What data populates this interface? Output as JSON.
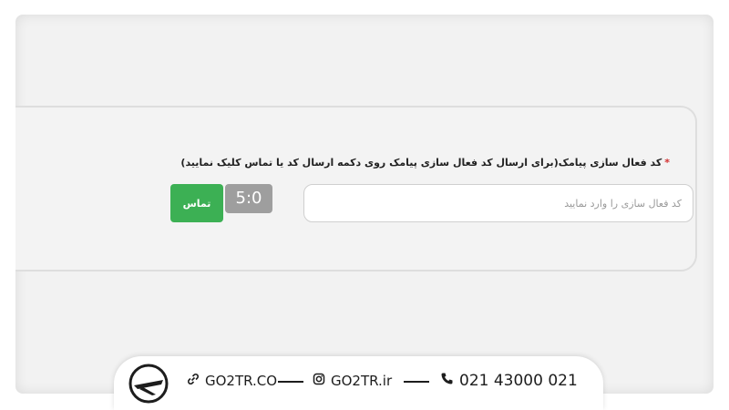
{
  "form": {
    "required_mark": "*",
    "label": "کد فعال سازی پیامک(برای ارسال کد فعال سازی پیامک روی دکمه ارسال کد یا تماس کلیک نمایید)",
    "input_placeholder": "کد فعال سازی را وارد نمایید",
    "input_value": "",
    "timer": "5:0",
    "call_button_label": "تماس"
  },
  "footer": {
    "website": "GO2TR.CO",
    "instagram": "GO2TR.ir",
    "phone": "021 43000 021",
    "icons": [
      "logo-icon",
      "link-icon",
      "instagram-icon",
      "phone-icon"
    ]
  },
  "colors": {
    "accent_green": "#3cb054",
    "timer_gray": "#9e9e9e",
    "required_red": "#d32f2f"
  }
}
